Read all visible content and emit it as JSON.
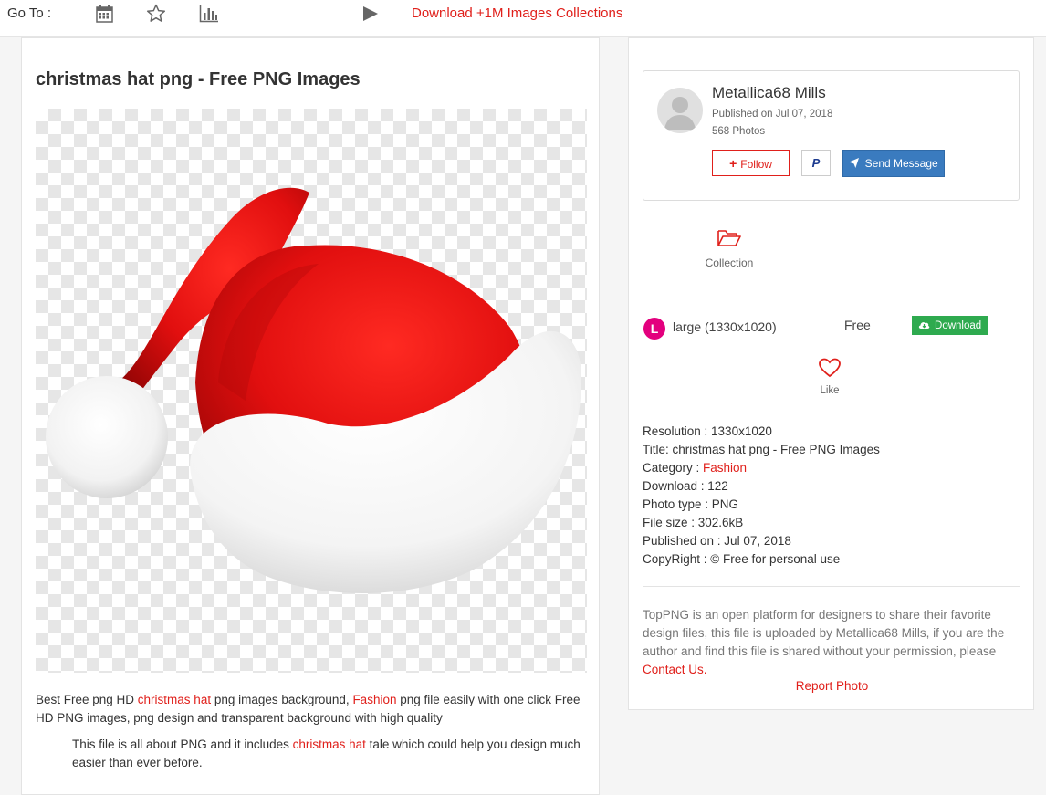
{
  "topbar": {
    "goto_label": "Go To :",
    "icons": [
      "calendar-icon",
      "star-icon",
      "bar-chart-icon",
      "play-icon"
    ],
    "download_link": "Download +1M Images Collections"
  },
  "image": {
    "title": "christmas hat png - Free PNG Images"
  },
  "description": {
    "p1_a": "Best Free png HD ",
    "p1_link1": "christmas hat",
    "p1_b": " png images background, ",
    "p1_link2": "Fashion",
    "p1_c": " png file easily with one click Free HD PNG images, png design and transparent background with high quality",
    "p2_a": "This file is all about PNG and it includes ",
    "p2_link": "christmas hat",
    "p2_b": " tale which could help you design much easier than ever before."
  },
  "author": {
    "name": "Metallica68 Mills",
    "published": "Published on Jul 07, 2018",
    "photos": "568 Photos",
    "follow_label": "Follow",
    "paypal_label": "P",
    "message_label": "Send Message"
  },
  "collection": {
    "label": "Collection"
  },
  "download": {
    "size_badge": "L",
    "size_label": "large (1330x1020)",
    "price": "Free",
    "button_label": "Download"
  },
  "like": {
    "label": "Like"
  },
  "meta": {
    "resolution": "Resolution : 1330x1020",
    "title": "Title: christmas hat png - Free PNG Images",
    "category_label": "Category : ",
    "category_value": "Fashion",
    "downloads": "Download : 122",
    "photo_type": "Photo type : PNG",
    "file_size": "File size : 302.6kB",
    "published": "Published on : Jul 07, 2018",
    "copyright": "CopyRight : © Free for personal use"
  },
  "notice": {
    "text": "TopPNG is an open platform for designers to share their favorite design files, this file is uploaded by Metallica68 Mills, if you are the author and find this file is shared without your permission, please ",
    "contact_link": "Contact Us.",
    "report_link": "Report Photo"
  },
  "colors": {
    "accent_red": "#e0201b",
    "message_blue": "#3a7bbf",
    "download_green": "#2eaa4f",
    "badge_magenta": "#e3007e"
  }
}
